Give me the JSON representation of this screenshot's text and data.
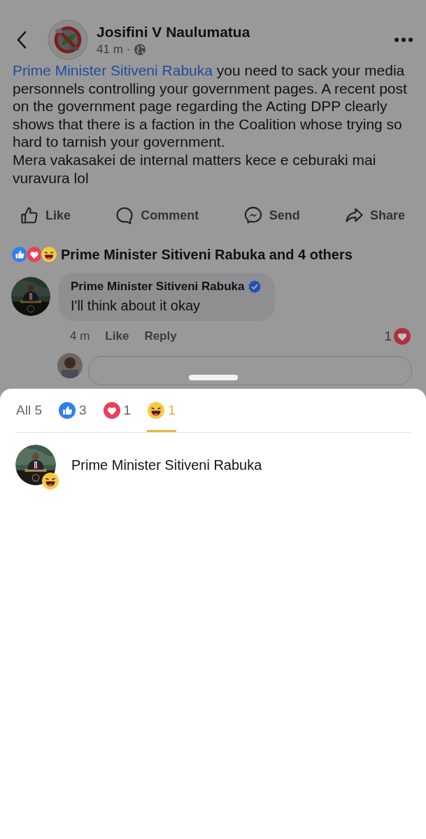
{
  "post": {
    "author": "Josifini V Naulumatua",
    "time": "41 m",
    "separator": "·",
    "mention": "Prime Minister Sitiveni Rabuka",
    "paragraphs": [
      "you need to sack your media personnels controlling your government pages. A recent post on the government  page  regarding the Acting DPP clearly shows that there is a faction in the Coalition whose trying so hard to tarnish your government.",
      "Mera vakasakei de internal matters kece e ceburaki mai vuravura lol"
    ]
  },
  "actions": [
    {
      "kind": "like",
      "label": "Like"
    },
    {
      "kind": "comment",
      "label": "Comment"
    },
    {
      "kind": "send",
      "label": "Send"
    },
    {
      "kind": "share",
      "label": "Share"
    }
  ],
  "reaction_summary": {
    "icons": [
      {
        "kind": "like"
      },
      {
        "kind": "love"
      },
      {
        "kind": "haha"
      }
    ],
    "text": "Prime Minister Sitiveni Rabuka and 4 others"
  },
  "comment": {
    "author": "Prime Minister Sitiveni Rabuka",
    "verified": true,
    "text": "I'll think about it okay",
    "time": "4 m",
    "like": "Like",
    "reply": "Reply",
    "reactions": [
      {
        "kind": "love",
        "count": "1"
      }
    ]
  },
  "sheet": {
    "tabs": [
      {
        "kind": "all",
        "label": "All 5",
        "selected": false
      },
      {
        "kind": "like",
        "label": "3",
        "selected": false
      },
      {
        "kind": "love",
        "label": "1",
        "selected": false
      },
      {
        "kind": "haha",
        "label": "1",
        "selected": true
      }
    ],
    "people": [
      {
        "name": "Prime Minister Sitiveni Rabuka",
        "badges": [
          {
            "kind": "haha"
          }
        ]
      }
    ]
  }
}
